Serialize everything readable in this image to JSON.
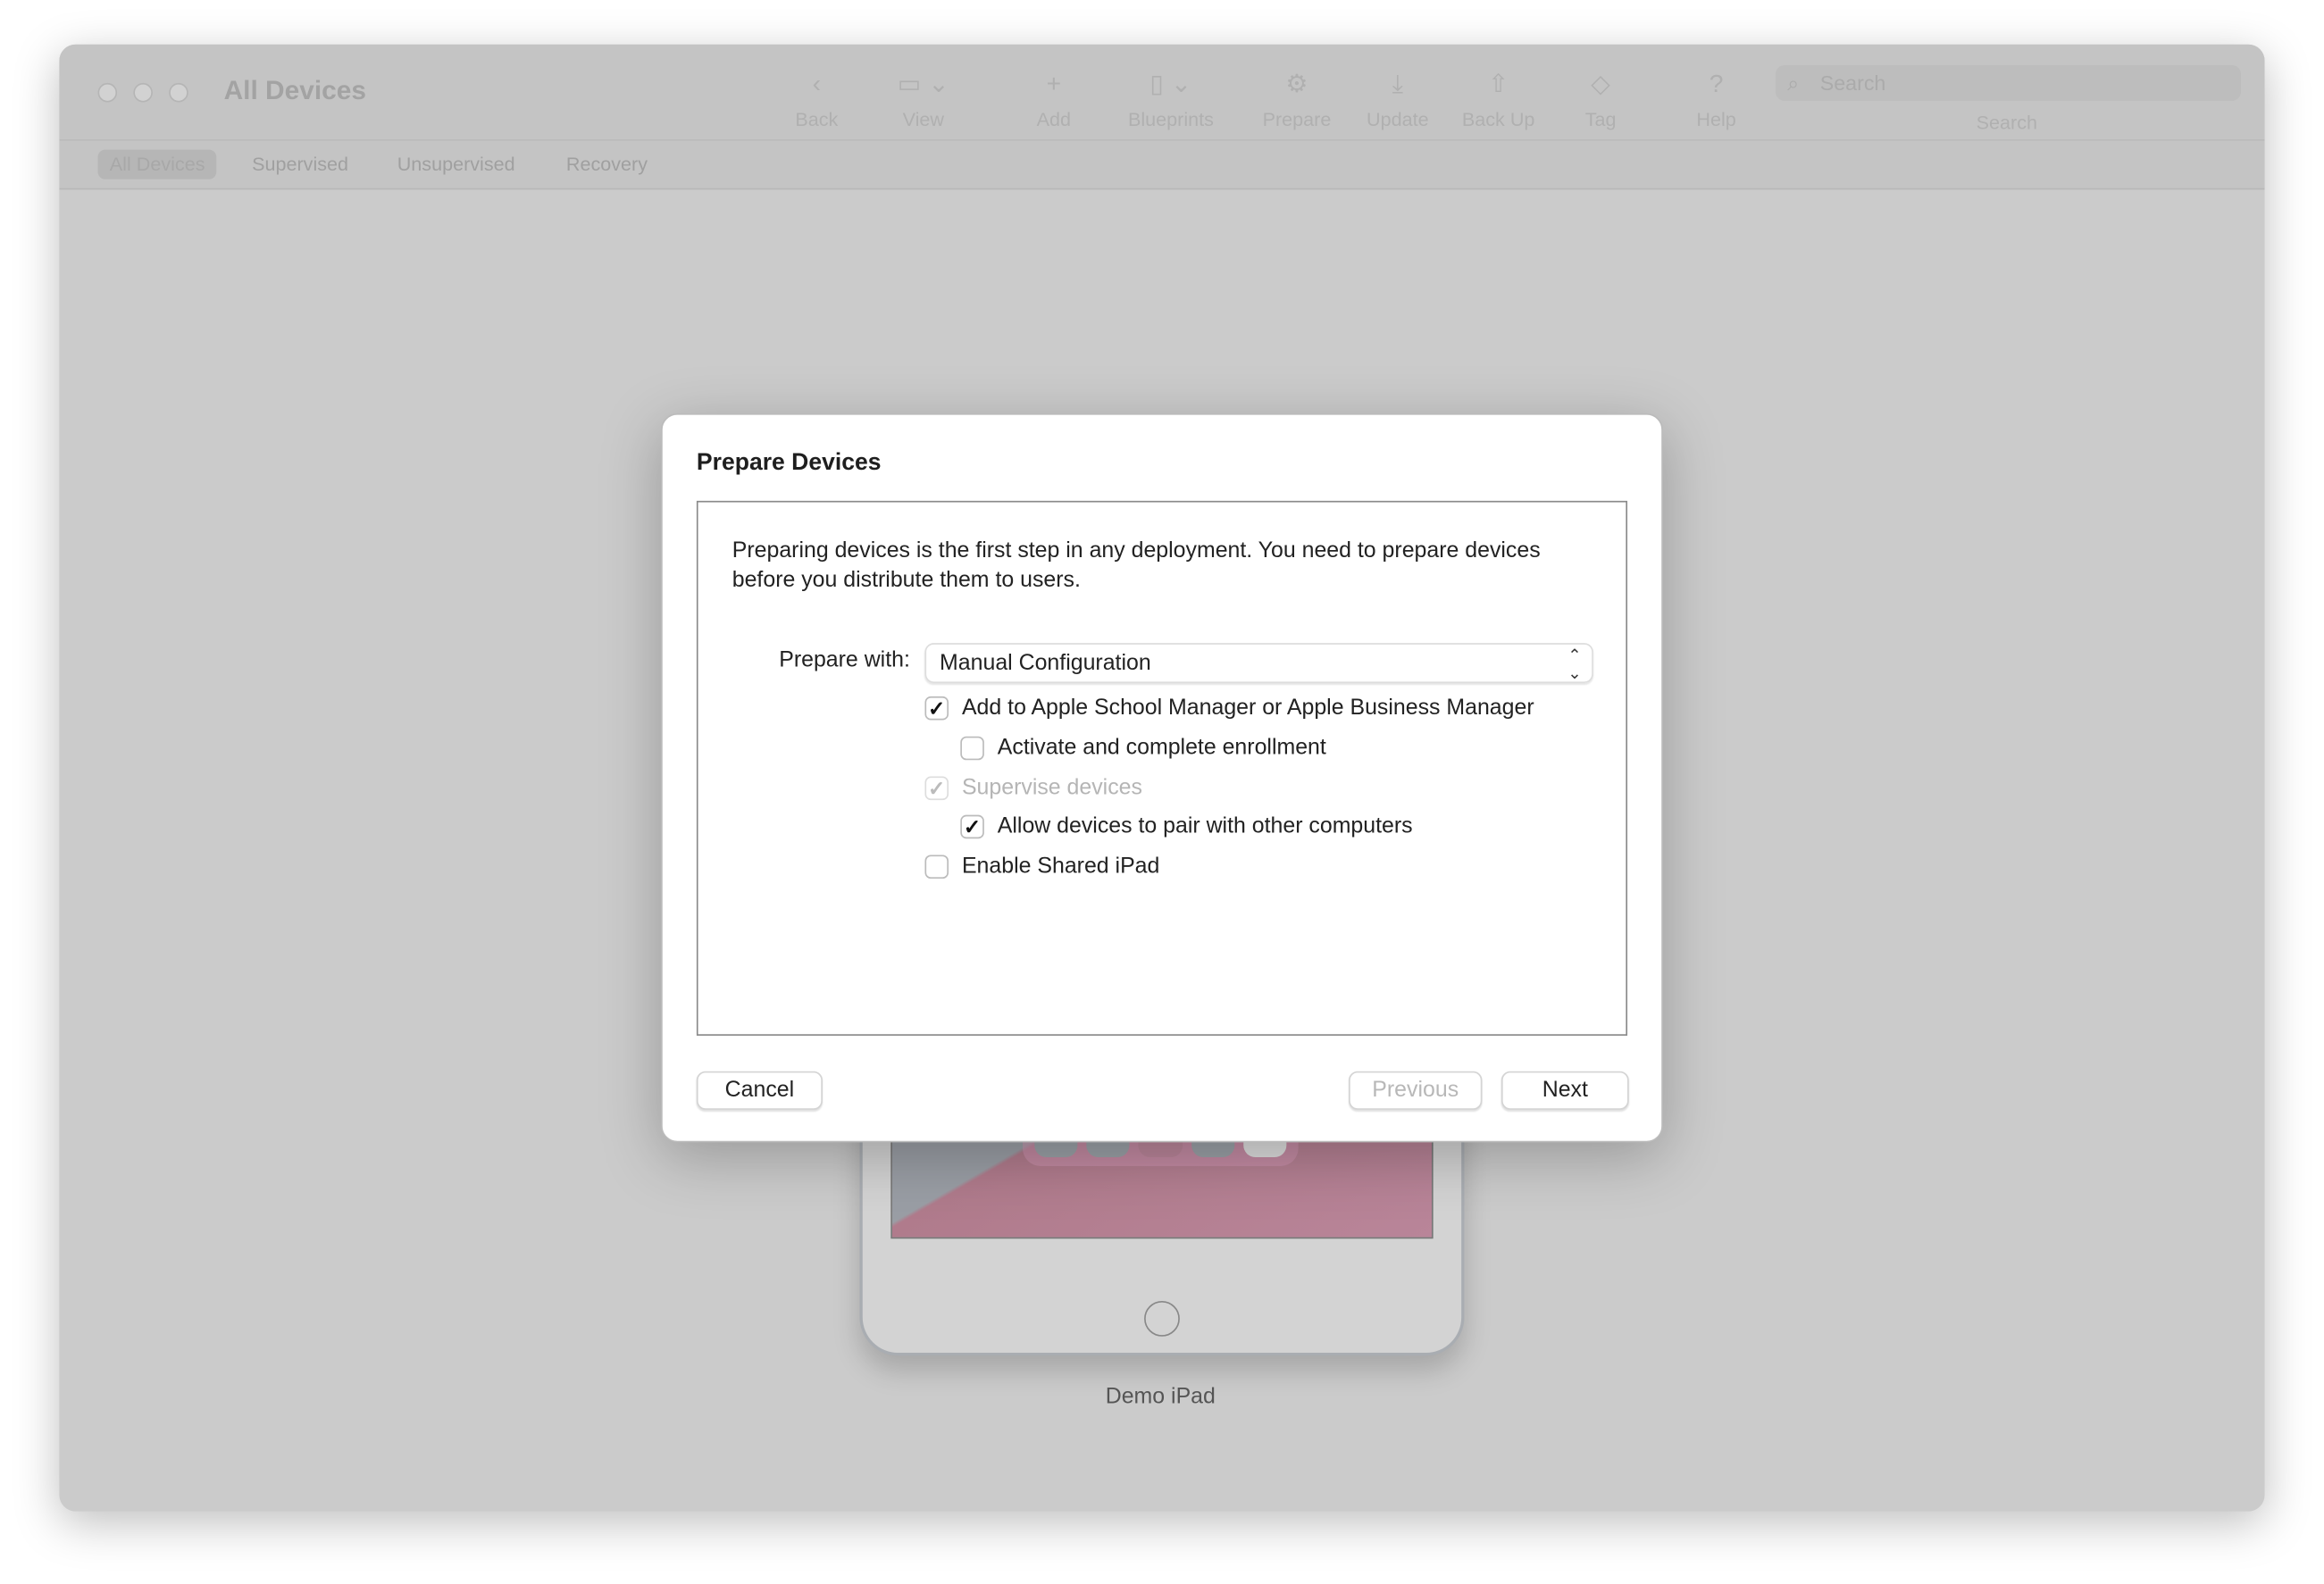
{
  "window": {
    "title": "All Devices"
  },
  "toolbar": {
    "items": [
      {
        "label": "Back",
        "icon": "chevron-left-icon",
        "glyph": "‹"
      },
      {
        "label": "View",
        "icon": "view-icon",
        "glyph": "▭ ⌄"
      },
      {
        "label": "Add",
        "icon": "plus-icon",
        "glyph": "+"
      },
      {
        "label": "Blueprints",
        "icon": "blueprints-icon",
        "glyph": "▯ ⌄"
      },
      {
        "label": "Prepare",
        "icon": "prepare-gear-icon",
        "glyph": "⚙"
      },
      {
        "label": "Update",
        "icon": "update-download-icon",
        "glyph": "⤓"
      },
      {
        "label": "Back Up",
        "icon": "backup-arrow-up-icon",
        "glyph": "⇧"
      },
      {
        "label": "Tag",
        "icon": "tag-icon",
        "glyph": "◇"
      },
      {
        "label": "Help",
        "icon": "help-icon",
        "glyph": "?"
      }
    ],
    "search": {
      "placeholder": "Search",
      "label": "Search"
    }
  },
  "tabs": [
    {
      "label": "All Devices",
      "selected": true
    },
    {
      "label": "Supervised"
    },
    {
      "label": "Unsupervised"
    },
    {
      "label": "Recovery"
    }
  ],
  "device": {
    "name": "Demo iPad",
    "dock_apps": [
      "messages-icon",
      "safari-icon",
      "music-icon",
      "mail-icon",
      "files-icon"
    ]
  },
  "dialog": {
    "title": "Prepare Devices",
    "intro": "Preparing devices is the first step in any deployment. You need to prepare devices before you distribute them to users.",
    "prepare_with_label": "Prepare with:",
    "prepare_with_value": "Manual Configuration",
    "options": [
      {
        "label": "Add to Apple School Manager or Apple Business Manager",
        "checked": true,
        "enabled": true,
        "level": 0
      },
      {
        "label": "Activate and complete enrollment",
        "checked": false,
        "enabled": true,
        "level": 1
      },
      {
        "label": "Supervise devices",
        "checked": true,
        "enabled": false,
        "level": 0
      },
      {
        "label": "Allow devices to pair with other computers",
        "checked": true,
        "enabled": true,
        "level": 1
      },
      {
        "label": "Enable Shared iPad",
        "checked": false,
        "enabled": true,
        "level": 0
      }
    ],
    "buttons": {
      "cancel": "Cancel",
      "previous": "Previous",
      "next": "Next",
      "previous_enabled": false
    }
  }
}
